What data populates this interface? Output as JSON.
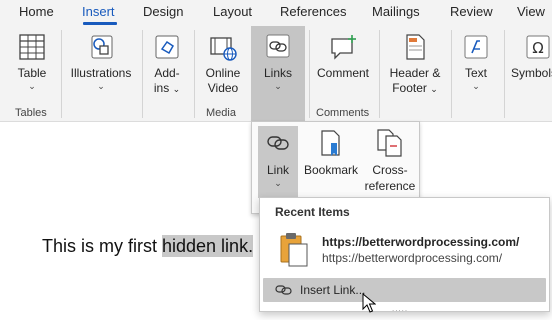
{
  "tabs": [
    {
      "label": "Home"
    },
    {
      "label": "Insert"
    },
    {
      "label": "Design"
    },
    {
      "label": "Layout"
    },
    {
      "label": "References"
    },
    {
      "label": "Mailings"
    },
    {
      "label": "Review"
    },
    {
      "label": "View"
    }
  ],
  "active_tab": "Insert",
  "accent_color": "#185abd",
  "ribbon": {
    "table": {
      "label": "Table",
      "icon": "table-icon"
    },
    "illustrations": {
      "label": "Illustrations",
      "icon": "shapes-icon"
    },
    "addins": {
      "label1": "Add-",
      "label2": "ins",
      "icon": "addins-icon"
    },
    "online_video": {
      "label1": "Online",
      "label2": "Video",
      "icon": "online-video-icon"
    },
    "links": {
      "label": "Links",
      "icon": "link-icon"
    },
    "comment": {
      "label": "Comment",
      "icon": "comment-icon"
    },
    "header_footer": {
      "label1": "Header &",
      "label2": "Footer",
      "icon": "header-footer-icon"
    },
    "text": {
      "label": "Text",
      "icon": "text-icon"
    },
    "symbols": {
      "label": "Symbols",
      "icon": "omega-icon"
    },
    "groups": {
      "tables": "Tables",
      "media": "Media",
      "comments": "Comments"
    }
  },
  "links_dropdown": {
    "link": {
      "label": "Link",
      "icon": "link-icon"
    },
    "bookmark": {
      "label": "Bookmark",
      "icon": "bookmark-icon"
    },
    "cross_reference": {
      "label1": "Cross-",
      "label2": "reference",
      "icon": "cross-reference-icon"
    }
  },
  "recent_items": {
    "title": "Recent Items",
    "item_bold": "https://betterwordprocessing.com/",
    "item_url": "https://betterwordprocessing.com/",
    "item_icon": "clipboard-icon",
    "insert_link_label": "Insert Link...",
    "insert_link_icon": "link-icon",
    "grip": "....."
  },
  "document": {
    "text_before": "This is my first ",
    "highlighted": "hidden link.",
    "highlight_color": "#c8c8c8"
  }
}
